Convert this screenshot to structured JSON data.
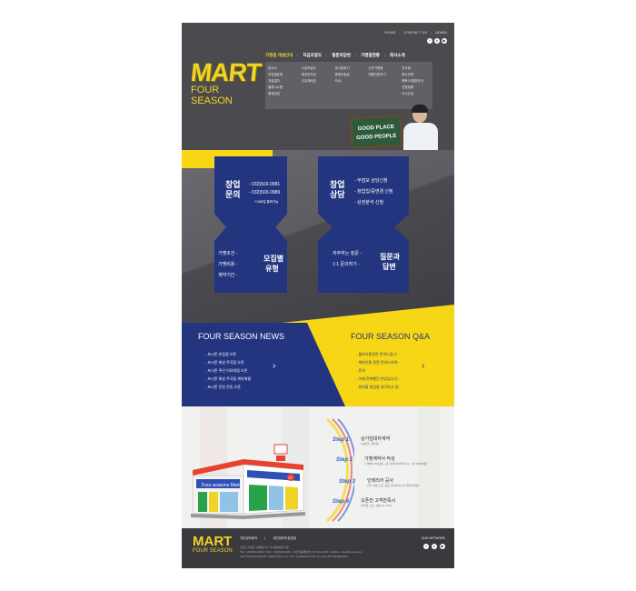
{
  "colors": {
    "accent_yellow": "#f7d715",
    "navy": "#23357f",
    "dark_grey": "#4b4b4f",
    "footer": "#3a3a3e"
  },
  "topnav": [
    "HOME",
    "CONTACT US",
    "ADMIN"
  ],
  "social": {
    "facebook": "f",
    "blog": "b",
    "youtube": "▶"
  },
  "logo": {
    "main": "MART",
    "sub": "FOUR SEASON"
  },
  "mainnav": [
    "가맹점 개설안내",
    "자금조달도",
    "질문과답변",
    "가맹점현황",
    "회사소개"
  ],
  "mega": [
    [
      "창사CI",
      "모집별유형",
      "개설절차",
      "물류시스템",
      "행정상담"
    ],
    [
      "자금조달도",
      "체성부자금",
      "수입채비금"
    ],
    [
      "공고업취기",
      "좋례무동값",
      "FAQ"
    ],
    [
      "신규가맹점",
      "제품관점포기"
    ],
    [
      "인사말",
      "회사연혁",
      "행복식/결방안내",
      "인원현황",
      "오시는길"
    ]
  ],
  "billboard": {
    "line1": "GOOD PLACE",
    "line2": "GOOD PEOPLE"
  },
  "card1": {
    "title1": "창업",
    "title2": "문의",
    "phone1": "- 032)503-0981",
    "phone2": "- 032)503-0989",
    "note": "※365일 통화가능",
    "items": [
      "가맹조건 -",
      "가맹비용 -",
      "계약기간 -"
    ],
    "bottom1": "모집별",
    "bottom2": "유형"
  },
  "card2": {
    "title1": "창업",
    "title2": "상담",
    "items": [
      "- 무점포 상담신청",
      "- 창업입/중변경 신청",
      "- 상권분석 신청"
    ],
    "faq": [
      "자주하는 질문 -",
      "1:1 문의하기 -"
    ],
    "bottom1": "질문과",
    "bottom2": "답변"
  },
  "news": {
    "title": "FOUR SEASON NEWS",
    "items": [
      "- 포시즌 손짐점 오픈",
      "- 포시즌 화성 주곡점 오픈",
      "- 포시즌 주인 이모데점 오픈",
      "- 포시즌 화성 주곡점 계약체결",
      "- 포시즌 진천 운동 오픈"
    ],
    "arrow": "›"
  },
  "qa": {
    "title": "FOUR SEASON Q&A",
    "items": [
      "- 월포유통관련 문의드립니~",
      "- 체와인통 관련 문의드리며~",
      "- 문의",
      "- 어제 전화했던 만업입니다~",
      "- 현의점 창업을 생각하고 있~"
    ],
    "arrow": "›"
  },
  "store": {
    "sign": "Four seasons Mart",
    "badge": "24"
  },
  "steps": [
    {
      "label": "Step 1",
      "title": "상가임대차계약",
      "sub": "(보증금, 권리금)"
    },
    {
      "label": "Step 2",
      "title": "가맹계약서 작성",
      "sub": "(가맹비 300만원 + 총 인테리어비의 1/2 ~ 영 1800만원)"
    },
    {
      "label": "Step 3",
      "title": "인테리어 공사",
      "sub": "(약7~9일 소요, 남은 공사비의 1/2 게이지야만)"
    },
    {
      "label": "Step 4",
      "title": "오픈전 고객만족시",
      "sub": "(약7일 소요, 상품 10~15%)"
    }
  ],
  "footer": {
    "logo_main": "MART",
    "logo_sub": "FOUR SEASON",
    "links": [
      "개인정보동의",
      "개인정보보호방침"
    ],
    "info1": "인천시 부평구 부평동 417-16 동양빌딩 5층",
    "info2": "TEL : 032)503-0981 / FAX : 032)503-0981 / 사업자등록번호 137-14-21291 / E-MAIL : fssv@naver.com",
    "info3": "COPYRIGHT 2018 BY 4SEASONS CO.,LTD. CORPORATION ALL RIGHTS RESERVED.",
    "sns_label": "SNS NETWORK"
  }
}
